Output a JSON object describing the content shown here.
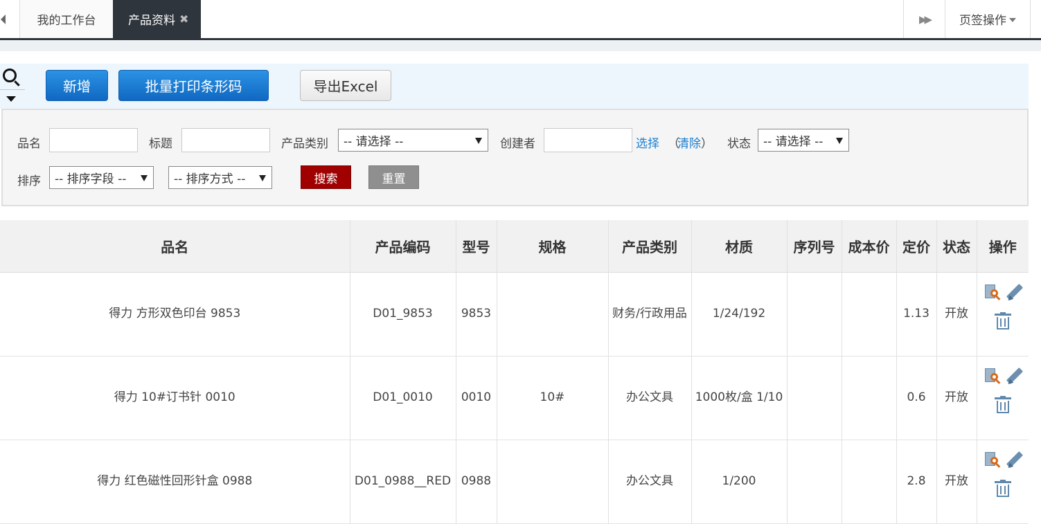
{
  "tabs": {
    "items": [
      {
        "label": "我的工作台",
        "active": false
      },
      {
        "label": "产品资料",
        "active": true,
        "close": "✖"
      }
    ],
    "next_icon": "fast-forward-icon",
    "ops_label": "页签操作"
  },
  "toolbar": {
    "add_label": "新增",
    "print_label": "批量打印条形码",
    "export_label": "导出Excel"
  },
  "filter": {
    "name_label": "品名",
    "title_label": "标题",
    "category_label": "产品类别",
    "category_value": "-- 请选择 --",
    "creator_label": "创建者",
    "select_link": "选择",
    "open_paren": "（",
    "clear_link": "清除",
    "close_paren": "）",
    "status_label": "状态",
    "status_value": "-- 请选择 --",
    "sort_label": "排序",
    "sort_field_value": "-- 排序字段 --",
    "sort_order_value": "-- 排序方式 --",
    "search_button": "搜索",
    "reset_button": "重置"
  },
  "table": {
    "headers": [
      "品名",
      "产品编码",
      "型号",
      "规格",
      "产品类别",
      "材质",
      "序列号",
      "成本价",
      "定价",
      "状态",
      "操作"
    ],
    "rows": [
      {
        "name": "得力 方形双色印台 9853",
        "code": "D01_9853",
        "model": "9853",
        "spec": "",
        "category": "财务/行政用品",
        "material": "1/24/192",
        "serial": "",
        "cost": "",
        "price": "1.13",
        "status": "开放"
      },
      {
        "name": "得力 10#订书针 0010",
        "code": "D01_0010",
        "model": "0010",
        "spec": "10#",
        "category": "办公文具",
        "material": "1000枚/盒 1/10",
        "serial": "",
        "cost": "",
        "price": "0.6",
        "status": "开放"
      },
      {
        "name": "得力 红色磁性回形针盒 0988",
        "code": "D01_0988__RED",
        "model": "0988",
        "spec": "",
        "category": "办公文具",
        "material": "1/200",
        "serial": "",
        "cost": "",
        "price": "2.8",
        "status": "开放"
      }
    ]
  },
  "colors": {
    "primary_blue": "#1a7fd6",
    "dark_tab": "#2f353d",
    "search_red": "#a00000",
    "reset_gray": "#8f8f8f",
    "link_blue": "#1b7fd1"
  }
}
